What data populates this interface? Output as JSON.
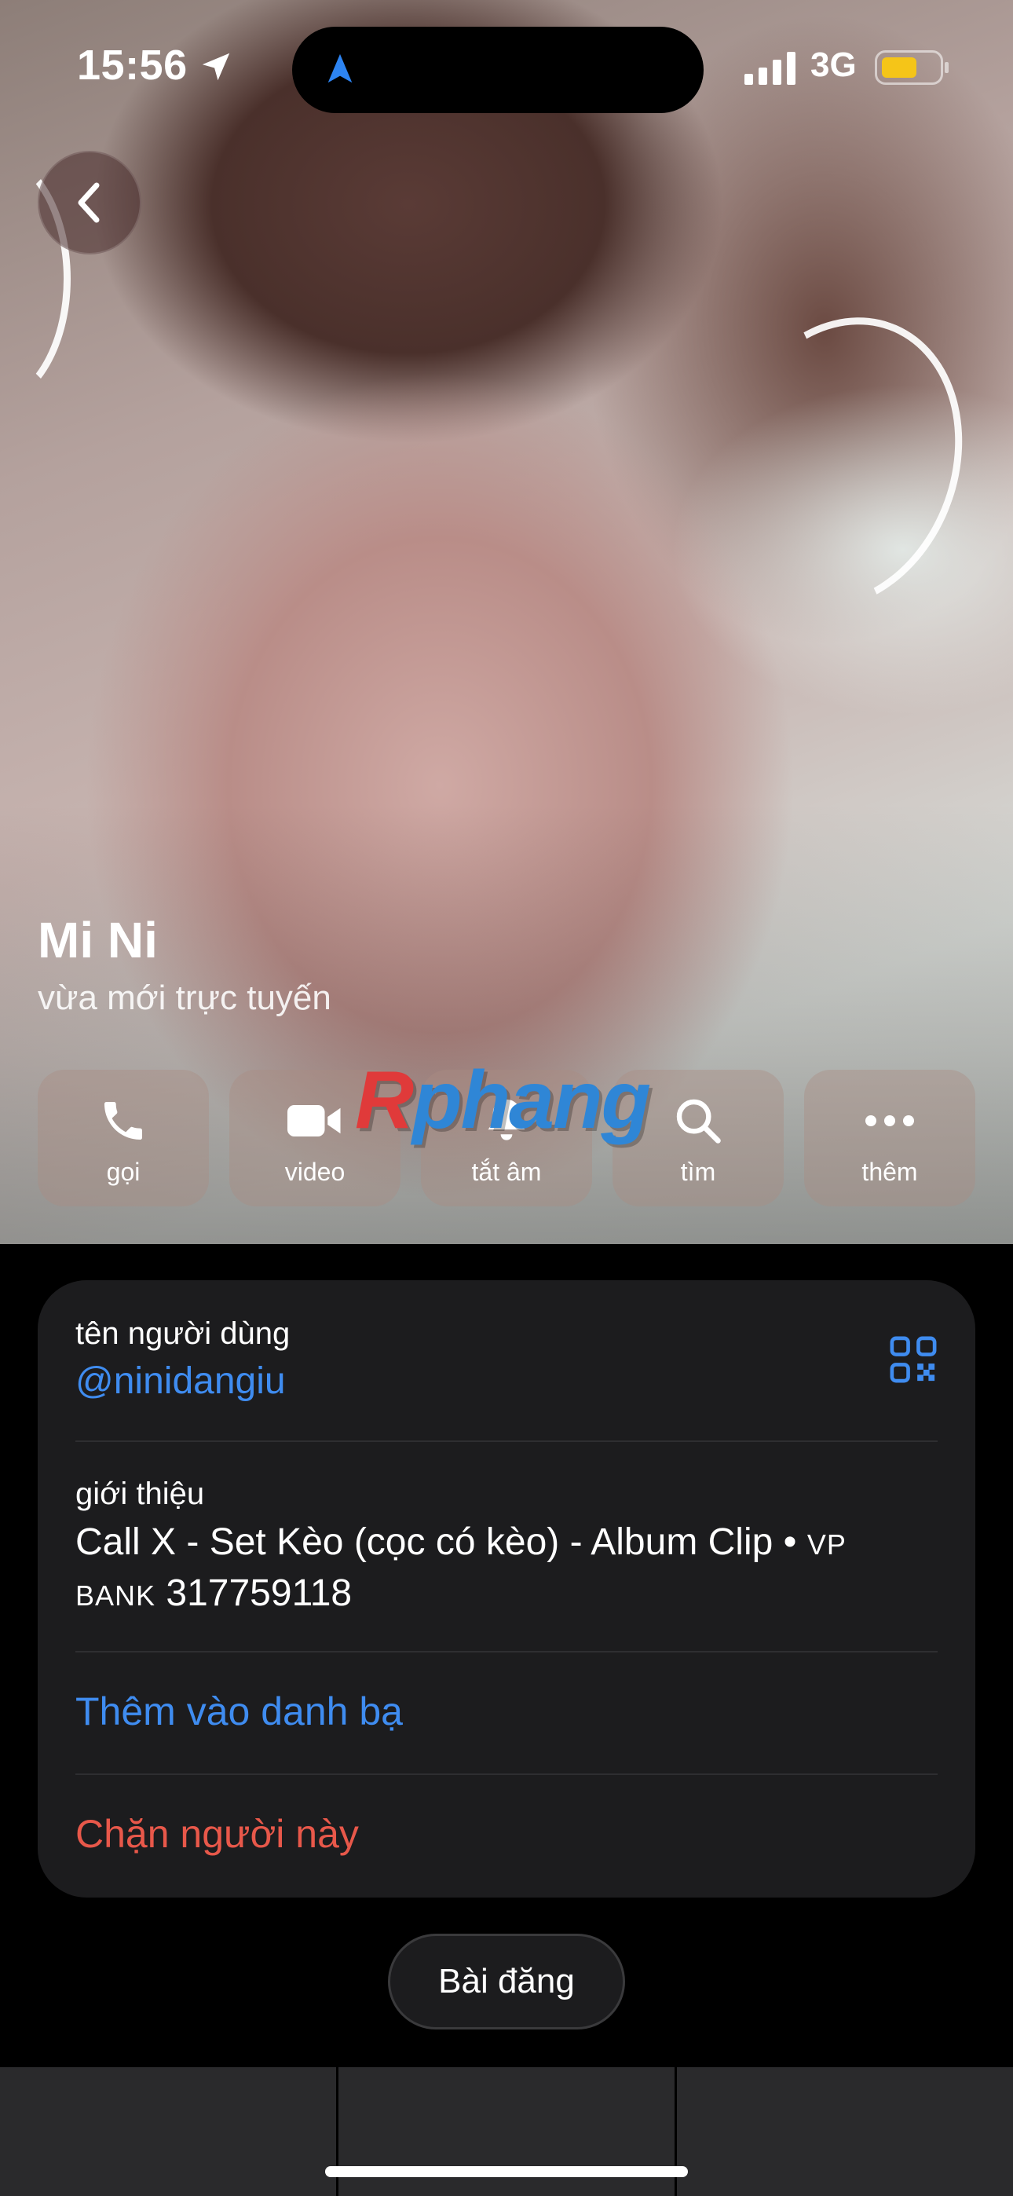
{
  "status_bar": {
    "time": "15:56",
    "network": "3G",
    "battery_color": "#f5c518"
  },
  "profile": {
    "name": "Mi Ni",
    "status": "vừa mới trực tuyến"
  },
  "actions": [
    {
      "label": "gọi",
      "icon": "phone-icon"
    },
    {
      "label": "video",
      "icon": "video-camera-icon"
    },
    {
      "label": "tắt âm",
      "icon": "bell-icon"
    },
    {
      "label": "tìm",
      "icon": "search-icon"
    },
    {
      "label": "thêm",
      "icon": "more-icon"
    }
  ],
  "watermark": {
    "first": "R",
    "rest": "phang"
  },
  "info": {
    "username_label": "tên người dùng",
    "username": "@ninidangiu",
    "bio_label": "giới thiệu",
    "bio_line1": "Call X - Set Kèo (cọc có kèo) - Album Clip •",
    "bio_small1": "VP",
    "bio_small2": "BANK",
    "bio_line2": "317759118",
    "add_contact": "Thêm vào danh bạ",
    "block": "Chặn người này"
  },
  "posts_button": "Bài đăng",
  "colors": {
    "link": "#3f8cf0",
    "danger": "#e8584a",
    "card": "#1c1c1e"
  }
}
